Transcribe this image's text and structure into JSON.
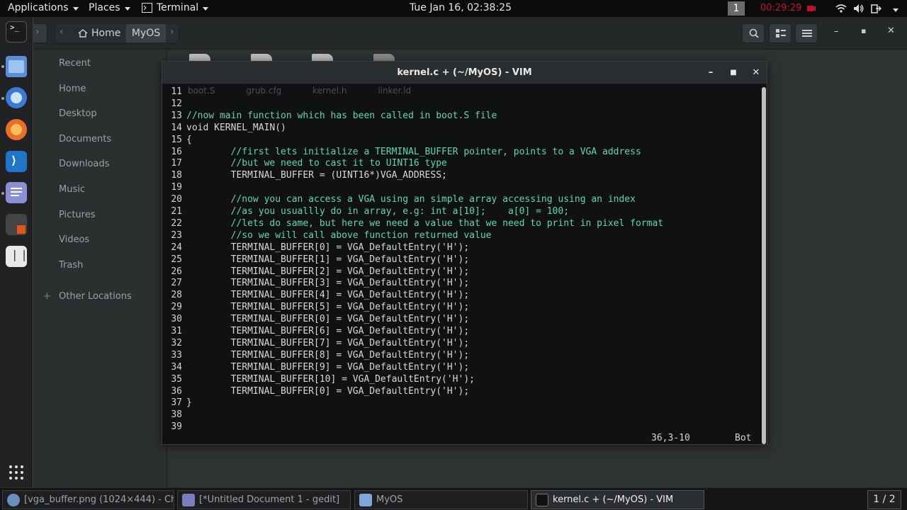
{
  "top_panel": {
    "applications_label": "Applications",
    "places_label": "Places",
    "terminal_label": "Terminal",
    "clock": "Tue Jan 16, 02:38:25",
    "workspace_number": "1",
    "recording_time": "00:29:29"
  },
  "files": {
    "breadcrumb_home": "Home",
    "breadcrumb_current": "MyOS",
    "sidebar": [
      {
        "label": "Recent",
        "icon": "clock-icon"
      },
      {
        "label": "Home",
        "icon": "home-icon"
      },
      {
        "label": "Desktop",
        "icon": "desktop-icon"
      },
      {
        "label": "Documents",
        "icon": "documents-icon"
      },
      {
        "label": "Downloads",
        "icon": "downloads-icon"
      },
      {
        "label": "Music",
        "icon": "music-icon"
      },
      {
        "label": "Pictures",
        "icon": "pictures-icon"
      },
      {
        "label": "Videos",
        "icon": "videos-icon"
      },
      {
        "label": "Trash",
        "icon": "trash-icon"
      },
      {
        "label": "Other Locations",
        "icon": "plus-icon"
      }
    ],
    "ghost_files": [
      "boot.S",
      "grub.cfg",
      "kernel.h",
      "linker.ld"
    ]
  },
  "vim": {
    "title": "kernel.c + (~/MyOS) - VIM",
    "lines": [
      {
        "n": "11",
        "text": "",
        "kind": "code"
      },
      {
        "n": "12",
        "text": "",
        "kind": "code"
      },
      {
        "n": "13",
        "text": "//now main function which has been called in boot.S file",
        "kind": "comment"
      },
      {
        "n": "14",
        "text": "void KERNEL_MAIN()",
        "kind": "code"
      },
      {
        "n": "15",
        "text": "{",
        "kind": "code"
      },
      {
        "n": "16",
        "text": "        //first lets initialize a TERMINAL_BUFFER pointer, points to a VGA address",
        "kind": "comment"
      },
      {
        "n": "17",
        "text": "        //but we need to cast it to UINT16 type",
        "kind": "comment"
      },
      {
        "n": "18",
        "text": "        TERMINAL_BUFFER = (UINT16*)VGA_ADDRESS;",
        "kind": "code"
      },
      {
        "n": "19",
        "text": "",
        "kind": "code"
      },
      {
        "n": "20",
        "text": "        //now you can access a VGA using an simple array accessing using an index",
        "kind": "comment"
      },
      {
        "n": "21",
        "text": "        //as you usuallly do in array, e.g: int a[10];    a[0] = 100;",
        "kind": "comment"
      },
      {
        "n": "22",
        "text": "        //lets do same, but here we need a value that we need to print in pixel format",
        "kind": "comment"
      },
      {
        "n": "23",
        "text": "        //so we will call above function returned value",
        "kind": "comment"
      },
      {
        "n": "24",
        "text": "        TERMINAL_BUFFER[0] = VGA_DefaultEntry('H');",
        "kind": "code"
      },
      {
        "n": "25",
        "text": "        TERMINAL_BUFFER[1] = VGA_DefaultEntry('H');",
        "kind": "code"
      },
      {
        "n": "26",
        "text": "        TERMINAL_BUFFER[2] = VGA_DefaultEntry('H');",
        "kind": "code"
      },
      {
        "n": "27",
        "text": "        TERMINAL_BUFFER[3] = VGA_DefaultEntry('H');",
        "kind": "code"
      },
      {
        "n": "28",
        "text": "        TERMINAL_BUFFER[4] = VGA_DefaultEntry('H');",
        "kind": "code"
      },
      {
        "n": "29",
        "text": "        TERMINAL_BUFFER[5] = VGA_DefaultEntry('H');",
        "kind": "code"
      },
      {
        "n": "30",
        "text": "        TERMINAL_BUFFER[0] = VGA_DefaultEntry('H');",
        "kind": "code"
      },
      {
        "n": "31",
        "text": "        TERMINAL_BUFFER[6] = VGA_DefaultEntry('H');",
        "kind": "code"
      },
      {
        "n": "32",
        "text": "        TERMINAL_BUFFER[7] = VGA_DefaultEntry('H');",
        "kind": "code"
      },
      {
        "n": "33",
        "text": "        TERMINAL_BUFFER[8] = VGA_DefaultEntry('H');",
        "kind": "code"
      },
      {
        "n": "34",
        "text": "        TERMINAL_BUFFER[9] = VGA_DefaultEntry('H');",
        "kind": "code"
      },
      {
        "n": "35",
        "text": "        TERMINAL_BUFFER[10] = VGA_DefaultEntry('H');",
        "kind": "code"
      },
      {
        "n": "36",
        "text": "        TERMINAL_BUFFER[0] = VGA_DefaultEntry('H');",
        "kind": "code"
      },
      {
        "n": "37",
        "text": "}",
        "kind": "code"
      },
      {
        "n": "38",
        "text": "",
        "kind": "code"
      },
      {
        "n": "39",
        "text": "",
        "kind": "code"
      }
    ],
    "cursor_position": "36,3-10",
    "scroll_position": "Bot"
  },
  "taskbar": {
    "tasks": [
      {
        "label": "[vga_buffer.png (1024×444) - Chr...",
        "icon": "chrome-icon",
        "active": false
      },
      {
        "label": "[*Untitled Document 1 - gedit]",
        "icon": "gedit-icon",
        "active": false
      },
      {
        "label": "MyOS",
        "icon": "folder-icon",
        "active": false
      },
      {
        "label": "kernel.c + (~/MyOS) - VIM",
        "icon": "terminal-icon",
        "active": true
      }
    ],
    "pager": "1 / 2"
  },
  "colors": {
    "comment": "#5fd7af",
    "recording": "#c4102a",
    "panel_bg": "#0b0b0b"
  }
}
